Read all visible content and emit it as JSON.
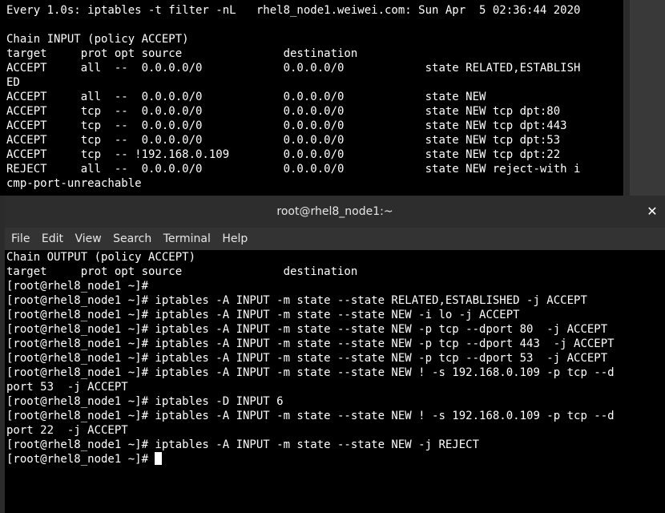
{
  "top_terminal": {
    "lines": [
      "Every 1.0s: iptables -t filter -nL   rhel8_node1.weiwei.com: Sun Apr  5 02:36:44 2020",
      "",
      "Chain INPUT (policy ACCEPT)",
      "target     prot opt source               destination",
      "ACCEPT     all  --  0.0.0.0/0            0.0.0.0/0            state RELATED,ESTABLISH",
      "ED",
      "ACCEPT     all  --  0.0.0.0/0            0.0.0.0/0            state NEW",
      "ACCEPT     tcp  --  0.0.0.0/0            0.0.0.0/0            state NEW tcp dpt:80",
      "ACCEPT     tcp  --  0.0.0.0/0            0.0.0.0/0            state NEW tcp dpt:443",
      "ACCEPT     tcp  --  0.0.0.0/0            0.0.0.0/0            state NEW tcp dpt:53",
      "ACCEPT     tcp  -- !192.168.0.109        0.0.0.0/0            state NEW tcp dpt:22",
      "REJECT     all  --  0.0.0.0/0            0.0.0.0/0            state NEW reject-with i",
      "cmp-port-unreachable"
    ]
  },
  "window": {
    "title": "root@rhel8_node1:~",
    "close_glyph": "✕",
    "menu": [
      "File",
      "Edit",
      "View",
      "Search",
      "Terminal",
      "Help"
    ]
  },
  "bottom_terminal": {
    "lines": [
      "Chain OUTPUT (policy ACCEPT)",
      "target     prot opt source               destination",
      "[root@rhel8_node1 ~]#",
      "[root@rhel8_node1 ~]# iptables -A INPUT -m state --state RELATED,ESTABLISHED -j ACCEPT",
      "[root@rhel8_node1 ~]# iptables -A INPUT -m state --state NEW -i lo -j ACCEPT",
      "[root@rhel8_node1 ~]# iptables -A INPUT -m state --state NEW -p tcp --dport 80  -j ACCEPT",
      "[root@rhel8_node1 ~]# iptables -A INPUT -m state --state NEW -p tcp --dport 443  -j ACCEPT",
      "[root@rhel8_node1 ~]# iptables -A INPUT -m state --state NEW -p tcp --dport 53  -j ACCEPT",
      "[root@rhel8_node1 ~]# iptables -A INPUT -m state --state NEW ! -s 192.168.0.109 -p tcp --d",
      "port 53  -j ACCEPT",
      "[root@rhel8_node1 ~]# iptables -D INPUT 6",
      "[root@rhel8_node1 ~]# iptables -A INPUT -m state --state NEW ! -s 192.168.0.109 -p tcp --d",
      "port 22  -j ACCEPT",
      "[root@rhel8_node1 ~]# iptables -A INPUT -m state --state NEW -j REJECT"
    ],
    "prompt": "[root@rhel8_node1 ~]# "
  },
  "colors": {
    "terminal_bg": "#000000",
    "terminal_fg": "#ffffff",
    "titlebar_bg": "#2d2d2d",
    "menubar_bg": "#333333"
  }
}
